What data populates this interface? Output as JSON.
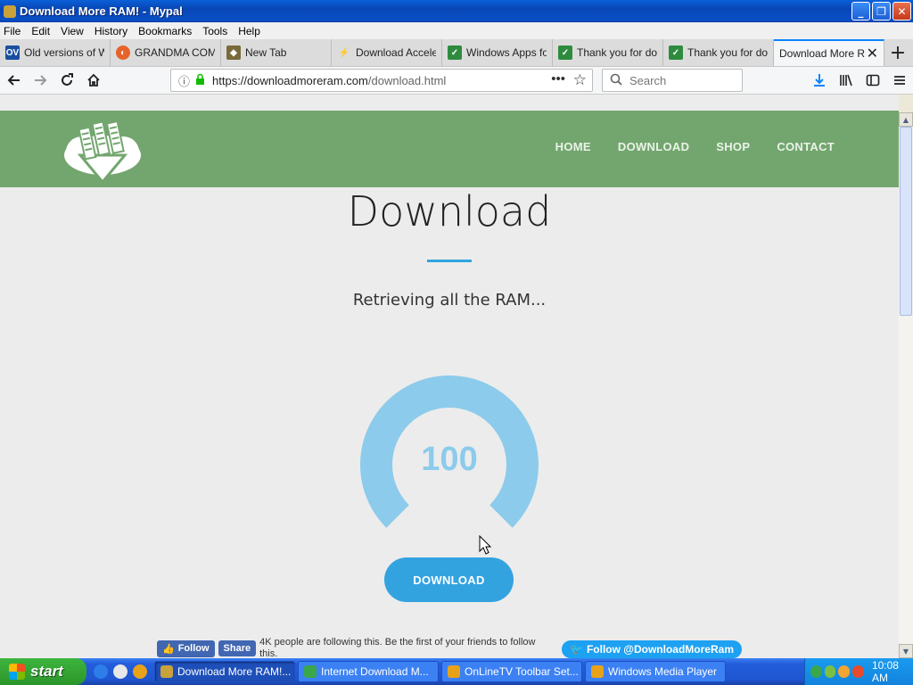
{
  "window": {
    "title": "Download More RAM! - Mypal",
    "buttons": {
      "minimize": "_",
      "maximize": "❐",
      "close": "✕"
    }
  },
  "menu": [
    "File",
    "Edit",
    "View",
    "History",
    "Bookmarks",
    "Tools",
    "Help"
  ],
  "tabs": [
    {
      "label": "Old versions of W",
      "favicon": "OV",
      "color": "#1a4fa0"
    },
    {
      "label": "GRANDMA COMP",
      "favicon": "◐",
      "color": "#e8632b"
    },
    {
      "label": "New Tab",
      "favicon": "◆",
      "color": "#7a6a3a"
    },
    {
      "label": "Download Accele",
      "favicon": "⚡",
      "color": "#f2c230"
    },
    {
      "label": "Windows Apps fo",
      "favicon": "✓",
      "color": "#2e8b3e"
    },
    {
      "label": "Thank you for do",
      "favicon": "✓",
      "color": "#2e8b3e"
    },
    {
      "label": "Thank you for do",
      "favicon": "✓",
      "color": "#2e8b3e"
    },
    {
      "label": "Download More R",
      "favicon": "",
      "color": "#f5f6f7",
      "active": true
    }
  ],
  "nav": {
    "url_host": "https://downloadmoreram.com",
    "url_path": "/download.html",
    "search_placeholder": "Search"
  },
  "site": {
    "nav": [
      "HOME",
      "DOWNLOAD",
      "SHOP",
      "CONTACT"
    ],
    "heading": "Download",
    "status": "Retrieving all the RAM...",
    "gauge_value": "100",
    "gauge_percent": 100,
    "download_button": "DOWNLOAD",
    "fb_follow": "Follow",
    "fb_share": "Share",
    "fb_text": "4K people are following this. Be the first of your friends to follow this.",
    "twitter_follow": "Follow @DownloadMoreRam"
  },
  "taskbar": {
    "start": "start",
    "tasks": [
      {
        "label": "Download More RAM!...",
        "color": "#c9a23a",
        "active": true
      },
      {
        "label": "Internet Download M...",
        "color": "#3aa74a"
      },
      {
        "label": "OnLineTV Toolbar Set...",
        "color": "#e8a21a"
      },
      {
        "label": "Windows Media Player",
        "color": "#e8a21a"
      }
    ],
    "clock": "10:08 AM"
  },
  "colors": {
    "header_green": "#73a66f",
    "accent_blue": "#33a3e0",
    "gauge_blue": "#8ccbeb"
  }
}
